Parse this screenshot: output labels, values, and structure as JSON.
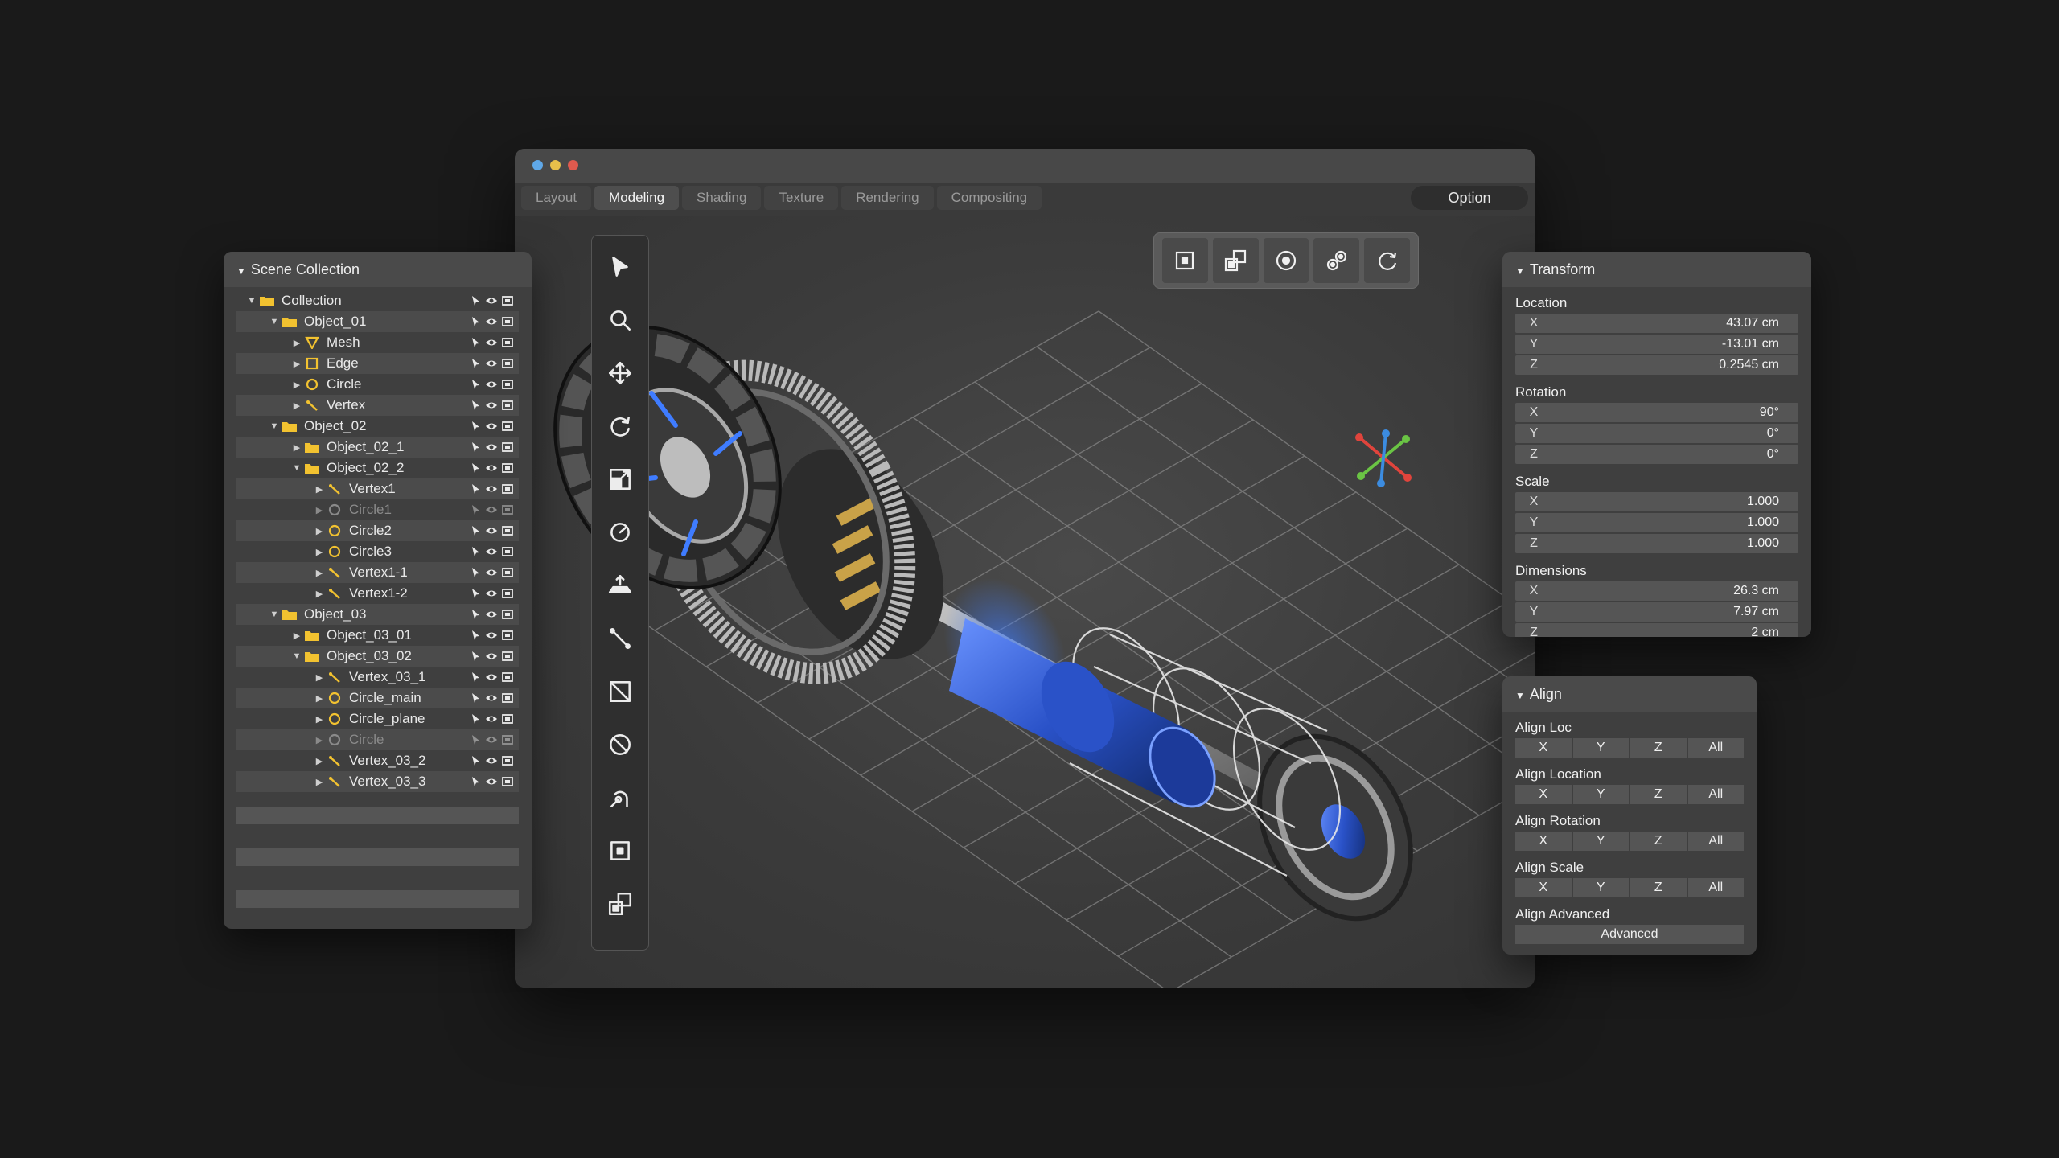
{
  "window": {
    "dots": [
      "#5fa8e8",
      "#e8c04a",
      "#e05a4e"
    ],
    "tabs": [
      {
        "label": "Layout",
        "active": false
      },
      {
        "label": "Modeling",
        "active": true
      },
      {
        "label": "Shading",
        "active": false
      },
      {
        "label": "Texture",
        "active": false
      },
      {
        "label": "Rendering",
        "active": false
      },
      {
        "label": "Compositing",
        "active": false
      }
    ],
    "option_label": "Option"
  },
  "toolbar": {
    "tools": [
      "select-cursor-icon",
      "zoom-icon",
      "move-icon",
      "rotate-icon",
      "scale-icon",
      "dial-icon",
      "extrude-icon",
      "line-icon",
      "crop-icon",
      "no-icon",
      "bend-icon",
      "origin-icon",
      "snap-icon"
    ]
  },
  "top_icons": [
    "frame-point-icon",
    "frame-objects-icon",
    "pivot-circle-icon",
    "links-icon",
    "refresh-icon"
  ],
  "scene_collection": {
    "title": "Scene Collection",
    "items": [
      {
        "label": "Collection",
        "level": 0,
        "arrow": "down",
        "icon": "folder",
        "alt": false,
        "dim": false
      },
      {
        "label": "Object_01",
        "level": 1,
        "arrow": "down",
        "icon": "folder",
        "alt": true,
        "dim": false
      },
      {
        "label": "Mesh",
        "level": 2,
        "arrow": "right",
        "icon": "mesh",
        "alt": false,
        "dim": false
      },
      {
        "label": "Edge",
        "level": 2,
        "arrow": "right",
        "icon": "edge",
        "alt": true,
        "dim": false
      },
      {
        "label": "Circle",
        "level": 2,
        "arrow": "right",
        "icon": "circle",
        "alt": false,
        "dim": false
      },
      {
        "label": "Vertex",
        "level": 2,
        "arrow": "right",
        "icon": "vertex",
        "alt": true,
        "dim": false
      },
      {
        "label": "Object_02",
        "level": 1,
        "arrow": "down",
        "icon": "folder",
        "alt": false,
        "dim": false
      },
      {
        "label": "Object_02_1",
        "level": 2,
        "arrow": "right",
        "icon": "folder",
        "alt": true,
        "dim": false
      },
      {
        "label": "Object_02_2",
        "level": 2,
        "arrow": "down",
        "icon": "folder",
        "alt": false,
        "dim": false
      },
      {
        "label": "Vertex1",
        "level": 3,
        "arrow": "right",
        "icon": "vertex",
        "alt": true,
        "dim": false
      },
      {
        "label": "Circle1",
        "level": 3,
        "arrow": "right",
        "icon": "circle",
        "alt": false,
        "dim": true
      },
      {
        "label": "Circle2",
        "level": 3,
        "arrow": "right",
        "icon": "circle",
        "alt": true,
        "dim": false
      },
      {
        "label": "Circle3",
        "level": 3,
        "arrow": "right",
        "icon": "circle",
        "alt": false,
        "dim": false
      },
      {
        "label": "Vertex1-1",
        "level": 3,
        "arrow": "right",
        "icon": "vertex",
        "alt": true,
        "dim": false
      },
      {
        "label": "Vertex1-2",
        "level": 3,
        "arrow": "right",
        "icon": "vertex",
        "alt": false,
        "dim": false
      },
      {
        "label": "Object_03",
        "level": 1,
        "arrow": "down",
        "icon": "folder",
        "alt": true,
        "dim": false
      },
      {
        "label": "Object_03_01",
        "level": 2,
        "arrow": "right",
        "icon": "folder",
        "alt": false,
        "dim": false
      },
      {
        "label": "Object_03_02",
        "level": 2,
        "arrow": "down",
        "icon": "folder",
        "alt": true,
        "dim": false
      },
      {
        "label": "Vertex_03_1",
        "level": 3,
        "arrow": "right",
        "icon": "vertex",
        "alt": false,
        "dim": false
      },
      {
        "label": "Circle_main",
        "level": 3,
        "arrow": "right",
        "icon": "circle",
        "alt": true,
        "dim": false
      },
      {
        "label": "Circle_plane",
        "level": 3,
        "arrow": "right",
        "icon": "circle",
        "alt": false,
        "dim": false
      },
      {
        "label": "Circle",
        "level": 3,
        "arrow": "right",
        "icon": "circle",
        "alt": true,
        "dim": true
      },
      {
        "label": "Vertex_03_2",
        "level": 3,
        "arrow": "right",
        "icon": "vertex",
        "alt": false,
        "dim": false
      },
      {
        "label": "Vertex_03_3",
        "level": 3,
        "arrow": "right",
        "icon": "vertex",
        "alt": true,
        "dim": false
      }
    ]
  },
  "transform": {
    "title": "Transform",
    "sections": [
      {
        "label": "Location",
        "rows": [
          {
            "axis": "X",
            "value": "43.07 cm"
          },
          {
            "axis": "Y",
            "value": "-13.01 cm"
          },
          {
            "axis": "Z",
            "value": "0.2545 cm"
          }
        ]
      },
      {
        "label": "Rotation",
        "rows": [
          {
            "axis": "X",
            "value": "90°"
          },
          {
            "axis": "Y",
            "value": "0°"
          },
          {
            "axis": "Z",
            "value": "0°"
          }
        ]
      },
      {
        "label": "Scale",
        "rows": [
          {
            "axis": "X",
            "value": "1.000"
          },
          {
            "axis": "Y",
            "value": "1.000"
          },
          {
            "axis": "Z",
            "value": "1.000"
          }
        ]
      },
      {
        "label": "Dimensions",
        "rows": [
          {
            "axis": "X",
            "value": "26.3 cm"
          },
          {
            "axis": "Y",
            "value": "7.97 cm"
          },
          {
            "axis": "Z",
            "value": "2 cm"
          }
        ]
      }
    ]
  },
  "align": {
    "title": "Align",
    "sections": [
      {
        "label": "Align Loc",
        "buttons": [
          "X",
          "Y",
          "Z",
          "All"
        ]
      },
      {
        "label": "Align Location",
        "buttons": [
          "X",
          "Y",
          "Z",
          "All"
        ]
      },
      {
        "label": "Align Rotation",
        "buttons": [
          "X",
          "Y",
          "Z",
          "All"
        ]
      },
      {
        "label": "Align Scale",
        "buttons": [
          "X",
          "Y",
          "Z",
          "All"
        ]
      },
      {
        "label": "Align Advanced",
        "buttons": [
          "Advanced"
        ]
      }
    ]
  },
  "colors": {
    "folder": "#f2c230",
    "accent_blue": "#2f5fd6",
    "gizmo_x": "#e0443c",
    "gizmo_y": "#6ac444",
    "gizmo_z": "#3c8ce0"
  }
}
